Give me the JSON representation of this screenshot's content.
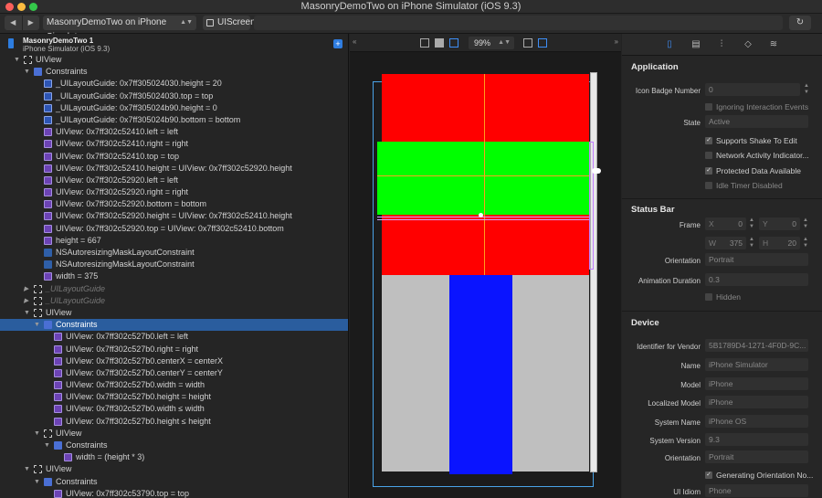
{
  "window": {
    "title": "MasonryDemoTwo on iPhone Simulator (iOS 9.3)"
  },
  "toolbar": {
    "back": "◀",
    "forward": "▶",
    "scheme": "MasonryDemoTwo on iPhone Simulator",
    "screen_button": "UIScreen",
    "refresh_icon": "↻"
  },
  "tree": {
    "app_title": "MasonryDemoTwo 1",
    "app_subtitle": "iPhone Simulator (iOS 9.3)",
    "rows": [
      {
        "text": "UIView",
        "indent": 0,
        "arrow": "▼",
        "icon": "view"
      },
      {
        "text": "Constraints",
        "indent": 1,
        "arrow": "▼",
        "icon": "cons"
      },
      {
        "text": "_UILayoutGuide: 0x7ff305024030.height = 20",
        "indent": 2,
        "icon": "lg"
      },
      {
        "text": "_UILayoutGuide: 0x7ff305024030.top = top",
        "indent": 2,
        "icon": "lg"
      },
      {
        "text": "_UILayoutGuide: 0x7ff305024b90.height = 0",
        "indent": 2,
        "icon": "lg"
      },
      {
        "text": "_UILayoutGuide: 0x7ff305024b90.bottom = bottom",
        "indent": 2,
        "icon": "lg"
      },
      {
        "text": "UIView: 0x7ff302c52410.left = left",
        "indent": 2,
        "icon": "cw"
      },
      {
        "text": "UIView: 0x7ff302c52410.right = right",
        "indent": 2,
        "icon": "cw"
      },
      {
        "text": "UIView: 0x7ff302c52410.top = top",
        "indent": 2,
        "icon": "cw"
      },
      {
        "text": "UIView: 0x7ff302c52410.height = UIView: 0x7ff302c52920.height",
        "indent": 2,
        "icon": "cw"
      },
      {
        "text": "UIView: 0x7ff302c52920.left = left",
        "indent": 2,
        "icon": "cw"
      },
      {
        "text": "UIView: 0x7ff302c52920.right = right",
        "indent": 2,
        "icon": "cw"
      },
      {
        "text": "UIView: 0x7ff302c52920.bottom = bottom",
        "indent": 2,
        "icon": "cw"
      },
      {
        "text": "UIView: 0x7ff302c52920.height = UIView: 0x7ff302c52410.height",
        "indent": 2,
        "icon": "cw"
      },
      {
        "text": "UIView: 0x7ff302c52920.top = UIView: 0x7ff302c52410.bottom",
        "indent": 2,
        "icon": "cw"
      },
      {
        "text": "height = 667",
        "indent": 2,
        "icon": "cw"
      },
      {
        "text": "NSAutoresizingMaskLayoutConstraint",
        "indent": 2,
        "icon": "q"
      },
      {
        "text": "NSAutoresizingMaskLayoutConstraint",
        "indent": 2,
        "icon": "q"
      },
      {
        "text": "width = 375",
        "indent": 2,
        "icon": "cw"
      },
      {
        "text": "_UILayoutGuide",
        "indent": 1,
        "arrow": "▶",
        "icon": "view",
        "dim": true
      },
      {
        "text": "_UILayoutGuide",
        "indent": 1,
        "arrow": "▶",
        "icon": "view",
        "dim": true
      },
      {
        "text": "UIView",
        "indent": 1,
        "arrow": "▼",
        "icon": "view"
      },
      {
        "text": "Constraints",
        "indent": 2,
        "arrow": "▼",
        "icon": "cons",
        "selected": true
      },
      {
        "text": "UIView: 0x7ff302c527b0.left = left",
        "indent": 3,
        "icon": "cw"
      },
      {
        "text": "UIView: 0x7ff302c527b0.right = right",
        "indent": 3,
        "icon": "cw"
      },
      {
        "text": "UIView: 0x7ff302c527b0.centerX = centerX",
        "indent": 3,
        "icon": "cw"
      },
      {
        "text": "UIView: 0x7ff302c527b0.centerY = centerY",
        "indent": 3,
        "icon": "cw"
      },
      {
        "text": "UIView: 0x7ff302c527b0.width = width",
        "indent": 3,
        "icon": "cw"
      },
      {
        "text": "UIView: 0x7ff302c527b0.height = height",
        "indent": 3,
        "icon": "cw"
      },
      {
        "text": "UIView: 0x7ff302c527b0.width ≤ width",
        "indent": 3,
        "icon": "cw"
      },
      {
        "text": "UIView: 0x7ff302c527b0.height ≤ height",
        "indent": 3,
        "icon": "cw"
      },
      {
        "text": "UIView",
        "indent": 2,
        "arrow": "▼",
        "icon": "view"
      },
      {
        "text": "Constraints",
        "indent": 3,
        "arrow": "▼",
        "icon": "cons"
      },
      {
        "text": "width = (height * 3)",
        "indent": 4,
        "icon": "cw"
      },
      {
        "text": "UIView",
        "indent": 1,
        "arrow": "▼",
        "icon": "view"
      },
      {
        "text": "Constraints",
        "indent": 2,
        "arrow": "▼",
        "icon": "cons"
      },
      {
        "text": "UIView: 0x7ff302c53790.top = top",
        "indent": 3,
        "icon": "cw"
      }
    ]
  },
  "canvas": {
    "zoom": "99%"
  },
  "inspector": {
    "application_title": "Application",
    "icon_badge_label": "Icon Badge Number",
    "icon_badge_value": "0",
    "ignoring_events": "Ignoring Interaction Events",
    "state_label": "State",
    "state_value": "Active",
    "shake_to_edit": "Supports Shake To Edit",
    "network_indicator": "Network Activity Indicator...",
    "protected_data": "Protected Data Available",
    "idle_timer": "Idle Timer Disabled",
    "status_bar_title": "Status Bar",
    "frame_label": "Frame",
    "x_label": "X",
    "x_value": "0",
    "y_label": "Y",
    "y_value": "0",
    "w_label": "W",
    "w_value": "375",
    "h_label": "H",
    "h_value": "20",
    "orientation_label": "Orientation",
    "orientation_value": "Portrait",
    "anim_label": "Animation Duration",
    "anim_value": "0.3",
    "hidden_label": "Hidden",
    "device_title": "Device",
    "vendor_label": "Identifier for Vendor",
    "vendor_value": "5B1789D4-1271-4F0D-9C...",
    "name_label": "Name",
    "name_value": "iPhone Simulator",
    "model_label": "Model",
    "model_value": "iPhone",
    "lmodel_label": "Localized Model",
    "lmodel_value": "iPhone",
    "sysname_label": "System Name",
    "sysname_value": "iPhone OS",
    "sysver_label": "System Version",
    "sysver_value": "9.3",
    "dorient_label": "Orientation",
    "dorient_value": "Portrait",
    "gen_orient": "Generating Orientation No...",
    "idiom_label": "UI Idiom",
    "idiom_value": "Phone"
  }
}
